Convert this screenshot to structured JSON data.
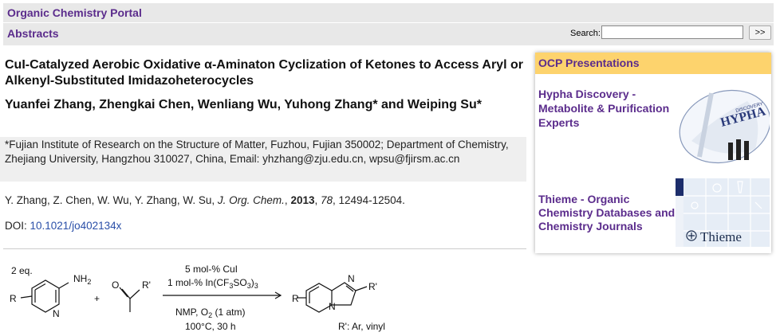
{
  "header": {
    "portal": "Organic Chemistry Portal",
    "section": "Abstracts"
  },
  "search": {
    "label": "Search:",
    "value": "",
    "button": ">>"
  },
  "article": {
    "title": "CuI-Catalyzed Aerobic Oxidative α-Aminaton Cyclization of Ketones to Access Aryl or Alkenyl-Substituted Imidazoheterocycles",
    "authors": "Yuanfei Zhang, Zhengkai Chen, Wenliang Wu, Yuhong Zhang* and Weiping Su*",
    "affiliation": "*Fujian Institute of Research on the Structure of Matter, Fuzhou, Fujian 350002; Department of Chemistry, Zhejiang University, Hangzhou 310027, China, Email: yhzhang@zju.edu.cn, wpsu@fjirsm.ac.cn",
    "citation": {
      "authors": "Y. Zhang, Z. Chen, W. Wu, Y. Zhang, W. Su, ",
      "journal": "J. Org. Chem.",
      "sep1": ", ",
      "year": "2013",
      "sep2": ", ",
      "volume": "78",
      "pages": ", 12494-12504."
    },
    "doi_label": "DOI: ",
    "doi": "10.1021/jo402134x"
  },
  "sidebar": {
    "header": "OCP Presentations",
    "ad1": {
      "text": "Hypha Discovery - Metabolite & Purification Experts",
      "logo": "HYPHA"
    },
    "ad2": {
      "text": "Thieme - Organic Chemistry Databases and Chemistry Journals",
      "logo": "Thieme"
    }
  },
  "scheme": {
    "equiv": "2 eq.",
    "cond1": "5 mol-% CuI",
    "cond2": "1 mol-% In(CF3SO3)3",
    "cond3": "NMP, O2 (1 atm)",
    "cond4": "100°C, 30 h",
    "r_note": "R': Ar, vinyl"
  }
}
